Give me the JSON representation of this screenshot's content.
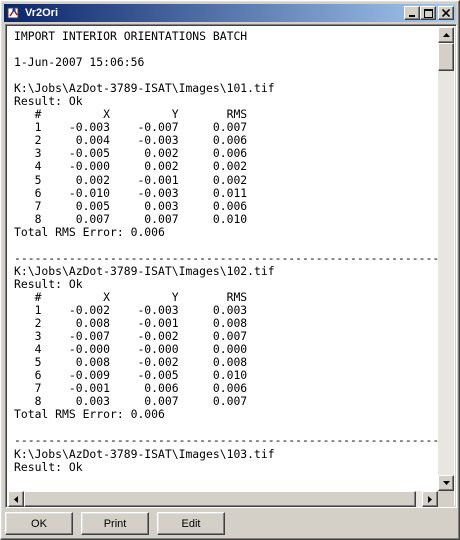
{
  "window": {
    "title": "Vr2Ori"
  },
  "report": {
    "lines": [
      "IMPORT INTERIOR ORIENTATIONS BATCH",
      "",
      "1-Jun-2007 15:06:56",
      "",
      "K:\\Jobs\\AzDot-3789-ISAT\\Images\\101.tif",
      "Result: Ok",
      "   #         X         Y       RMS",
      "   1    -0.003    -0.007     0.007",
      "   2     0.004    -0.003     0.006",
      "   3    -0.005     0.002     0.006",
      "   4    -0.000     0.002     0.002",
      "   5     0.002    -0.001     0.002",
      "   6    -0.010    -0.003     0.011",
      "   7     0.005     0.003     0.006",
      "   8     0.007     0.007     0.010",
      "Total RMS Error: 0.006",
      "",
      "------------------------------------------------------------------------",
      "K:\\Jobs\\AzDot-3789-ISAT\\Images\\102.tif",
      "Result: Ok",
      "   #         X         Y       RMS",
      "   1    -0.002    -0.003     0.003",
      "   2     0.008    -0.001     0.008",
      "   3    -0.007    -0.002     0.007",
      "   4    -0.000    -0.000     0.000",
      "   5     0.008    -0.002     0.008",
      "   6    -0.009    -0.005     0.010",
      "   7    -0.001     0.006     0.006",
      "   8     0.003     0.007     0.007",
      "Total RMS Error: 0.006",
      "",
      "------------------------------------------------------------------------",
      "K:\\Jobs\\AzDot-3789-ISAT\\Images\\103.tif",
      "Result: Ok"
    ]
  },
  "buttons": {
    "ok": "OK",
    "print": "Print",
    "edit": "Edit"
  },
  "scrollbars": {
    "vertical_position": 0.0,
    "horizontal_position": 0.0
  },
  "colors": {
    "titlebar_start": "#0a246a",
    "titlebar_end": "#a6caf0",
    "face": "#d4d0c8"
  }
}
